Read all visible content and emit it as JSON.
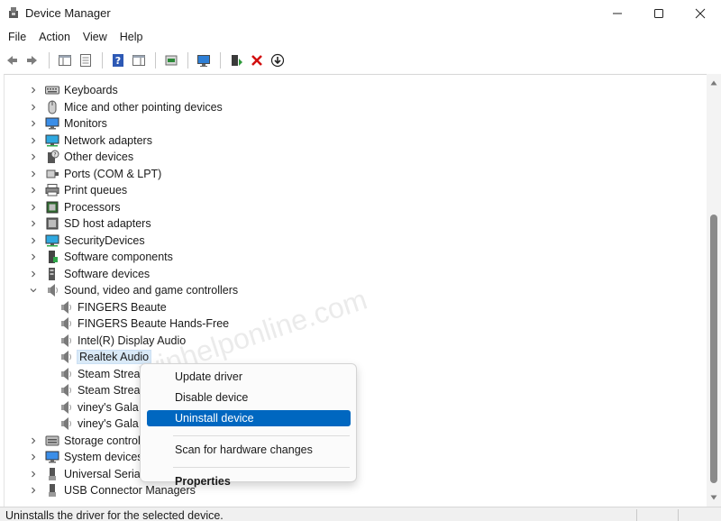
{
  "window": {
    "title": "Device Manager",
    "controls": [
      "minimize",
      "maximize",
      "close"
    ]
  },
  "menu": [
    "File",
    "Action",
    "View",
    "Help"
  ],
  "toolbar": [
    {
      "name": "back-button",
      "icon": "arrow-left-icon"
    },
    {
      "name": "forward-button",
      "icon": "arrow-right-icon"
    },
    {
      "name": "show-hide-console-tree-button",
      "icon": "console-tree-icon"
    },
    {
      "name": "properties-button",
      "icon": "properties-icon"
    },
    {
      "name": "help-button",
      "icon": "help-icon"
    },
    {
      "name": "action-pane-button",
      "icon": "action-pane-icon"
    },
    {
      "name": "update-driver-button",
      "icon": "update-driver-icon"
    },
    {
      "name": "scan-hardware-button",
      "icon": "monitor-scan-icon"
    },
    {
      "name": "enable-device-button",
      "icon": "add-device-icon"
    },
    {
      "name": "uninstall-device-button",
      "icon": "red-x-icon"
    },
    {
      "name": "disable-device-button",
      "icon": "down-arrow-circle-icon"
    }
  ],
  "tree": [
    {
      "label": "Keyboards",
      "icon": "keyboard-icon",
      "level": 0,
      "expander": "collapsed"
    },
    {
      "label": "Mice and other pointing devices",
      "icon": "mouse-icon",
      "level": 0,
      "expander": "collapsed"
    },
    {
      "label": "Monitors",
      "icon": "monitor-icon",
      "level": 0,
      "expander": "collapsed"
    },
    {
      "label": "Network adapters",
      "icon": "network-icon",
      "level": 0,
      "expander": "collapsed"
    },
    {
      "label": "Other devices",
      "icon": "unknown-device-icon",
      "level": 0,
      "expander": "collapsed"
    },
    {
      "label": "Ports (COM & LPT)",
      "icon": "port-icon",
      "level": 0,
      "expander": "collapsed"
    },
    {
      "label": "Print queues",
      "icon": "printer-icon",
      "level": 0,
      "expander": "collapsed"
    },
    {
      "label": "Processors",
      "icon": "processor-icon",
      "level": 0,
      "expander": "collapsed"
    },
    {
      "label": "SD host adapters",
      "icon": "sd-card-icon",
      "level": 0,
      "expander": "collapsed"
    },
    {
      "label": "SecurityDevices",
      "icon": "security-device-icon",
      "level": 0,
      "expander": "collapsed"
    },
    {
      "label": "Software components",
      "icon": "software-component-icon",
      "level": 0,
      "expander": "collapsed"
    },
    {
      "label": "Software devices",
      "icon": "software-device-icon",
      "level": 0,
      "expander": "collapsed"
    },
    {
      "label": "Sound, video and game controllers",
      "icon": "speaker-icon",
      "level": 0,
      "expander": "expanded"
    },
    {
      "label": "FINGERS Beaute",
      "icon": "speaker-icon",
      "level": 1,
      "expander": "none"
    },
    {
      "label": "FINGERS Beaute Hands-Free",
      "icon": "speaker-icon",
      "level": 1,
      "expander": "none"
    },
    {
      "label": "Intel(R) Display Audio",
      "icon": "speaker-icon",
      "level": 1,
      "expander": "none"
    },
    {
      "label": "Realtek Audio",
      "icon": "speaker-icon",
      "level": 1,
      "expander": "none",
      "selected": true
    },
    {
      "label": "Steam Strea",
      "icon": "speaker-icon",
      "level": 1,
      "expander": "none"
    },
    {
      "label": "Steam Strea",
      "icon": "speaker-icon",
      "level": 1,
      "expander": "none"
    },
    {
      "label": "viney's Gala",
      "icon": "speaker-icon",
      "level": 1,
      "expander": "none"
    },
    {
      "label": "viney's Gala",
      "icon": "speaker-icon",
      "level": 1,
      "expander": "none"
    },
    {
      "label": "Storage controll",
      "icon": "storage-icon",
      "level": 0,
      "expander": "collapsed"
    },
    {
      "label": "System devices",
      "icon": "system-device-icon",
      "level": 0,
      "expander": "collapsed"
    },
    {
      "label": "Universal Serial",
      "icon": "usb-icon",
      "level": 0,
      "expander": "collapsed"
    },
    {
      "label": "USB Connector Managers",
      "icon": "usb-icon",
      "level": 0,
      "expander": "collapsed"
    }
  ],
  "context_menu": {
    "items": [
      {
        "label": "Update driver",
        "highlight": false,
        "bold": false
      },
      {
        "label": "Disable device",
        "highlight": false,
        "bold": false
      },
      {
        "label": "Uninstall device",
        "highlight": true,
        "bold": false
      },
      {
        "separator": true
      },
      {
        "label": "Scan for hardware changes",
        "highlight": false,
        "bold": false
      },
      {
        "separator": true
      },
      {
        "label": "Properties",
        "highlight": false,
        "bold": true
      }
    ]
  },
  "status": {
    "text": "Uninstalls the driver for the selected device."
  },
  "watermark": {
    "text": "winhelponline.com"
  },
  "colors": {
    "accent": "#0067c0",
    "selection": "#d9e9f7",
    "uninstall_red": "#d20f0f"
  }
}
